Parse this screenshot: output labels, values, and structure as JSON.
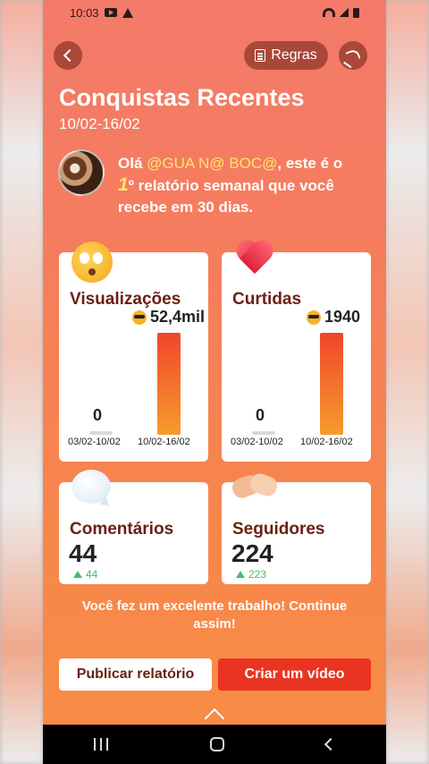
{
  "status": {
    "time": "10:03"
  },
  "header": {
    "rules_label": "Regras",
    "title": "Conquistas Recentes",
    "date_range": "10/02-16/02"
  },
  "greeting": {
    "prefix": "Olá ",
    "handle": "@GUA N@ BOC@",
    "mid": ", este é o ",
    "ordinal": "1",
    "ordinal_suffix": "º",
    "suffix": " relatório semanal que você recebe em 30 dias."
  },
  "cards": {
    "views": {
      "title": "Visualizações",
      "current": "52,4mil",
      "previous": "0",
      "prev_period": "03/02-10/02",
      "curr_period": "10/02-16/02",
      "fill_fraction": 1.0
    },
    "likes": {
      "title": "Curtidas",
      "current": "1940",
      "previous": "0",
      "prev_period": "03/02-10/02",
      "curr_period": "10/02-16/02",
      "fill_fraction": 1.0
    },
    "comments": {
      "title": "Comentários",
      "value": "44",
      "delta": "44"
    },
    "followers": {
      "title": "Seguidores",
      "value": "224",
      "delta": "223"
    }
  },
  "message": "Você fez um excelente trabalho! Continue assim!",
  "actions": {
    "publish_label": "Publicar relatório",
    "video_label": "Criar um vídeo"
  },
  "colors": {
    "accent": "#ea3422",
    "title_dark": "#6b1f12",
    "delta_green": "#3ec06a",
    "handle_yellow": "#ffe66b"
  }
}
